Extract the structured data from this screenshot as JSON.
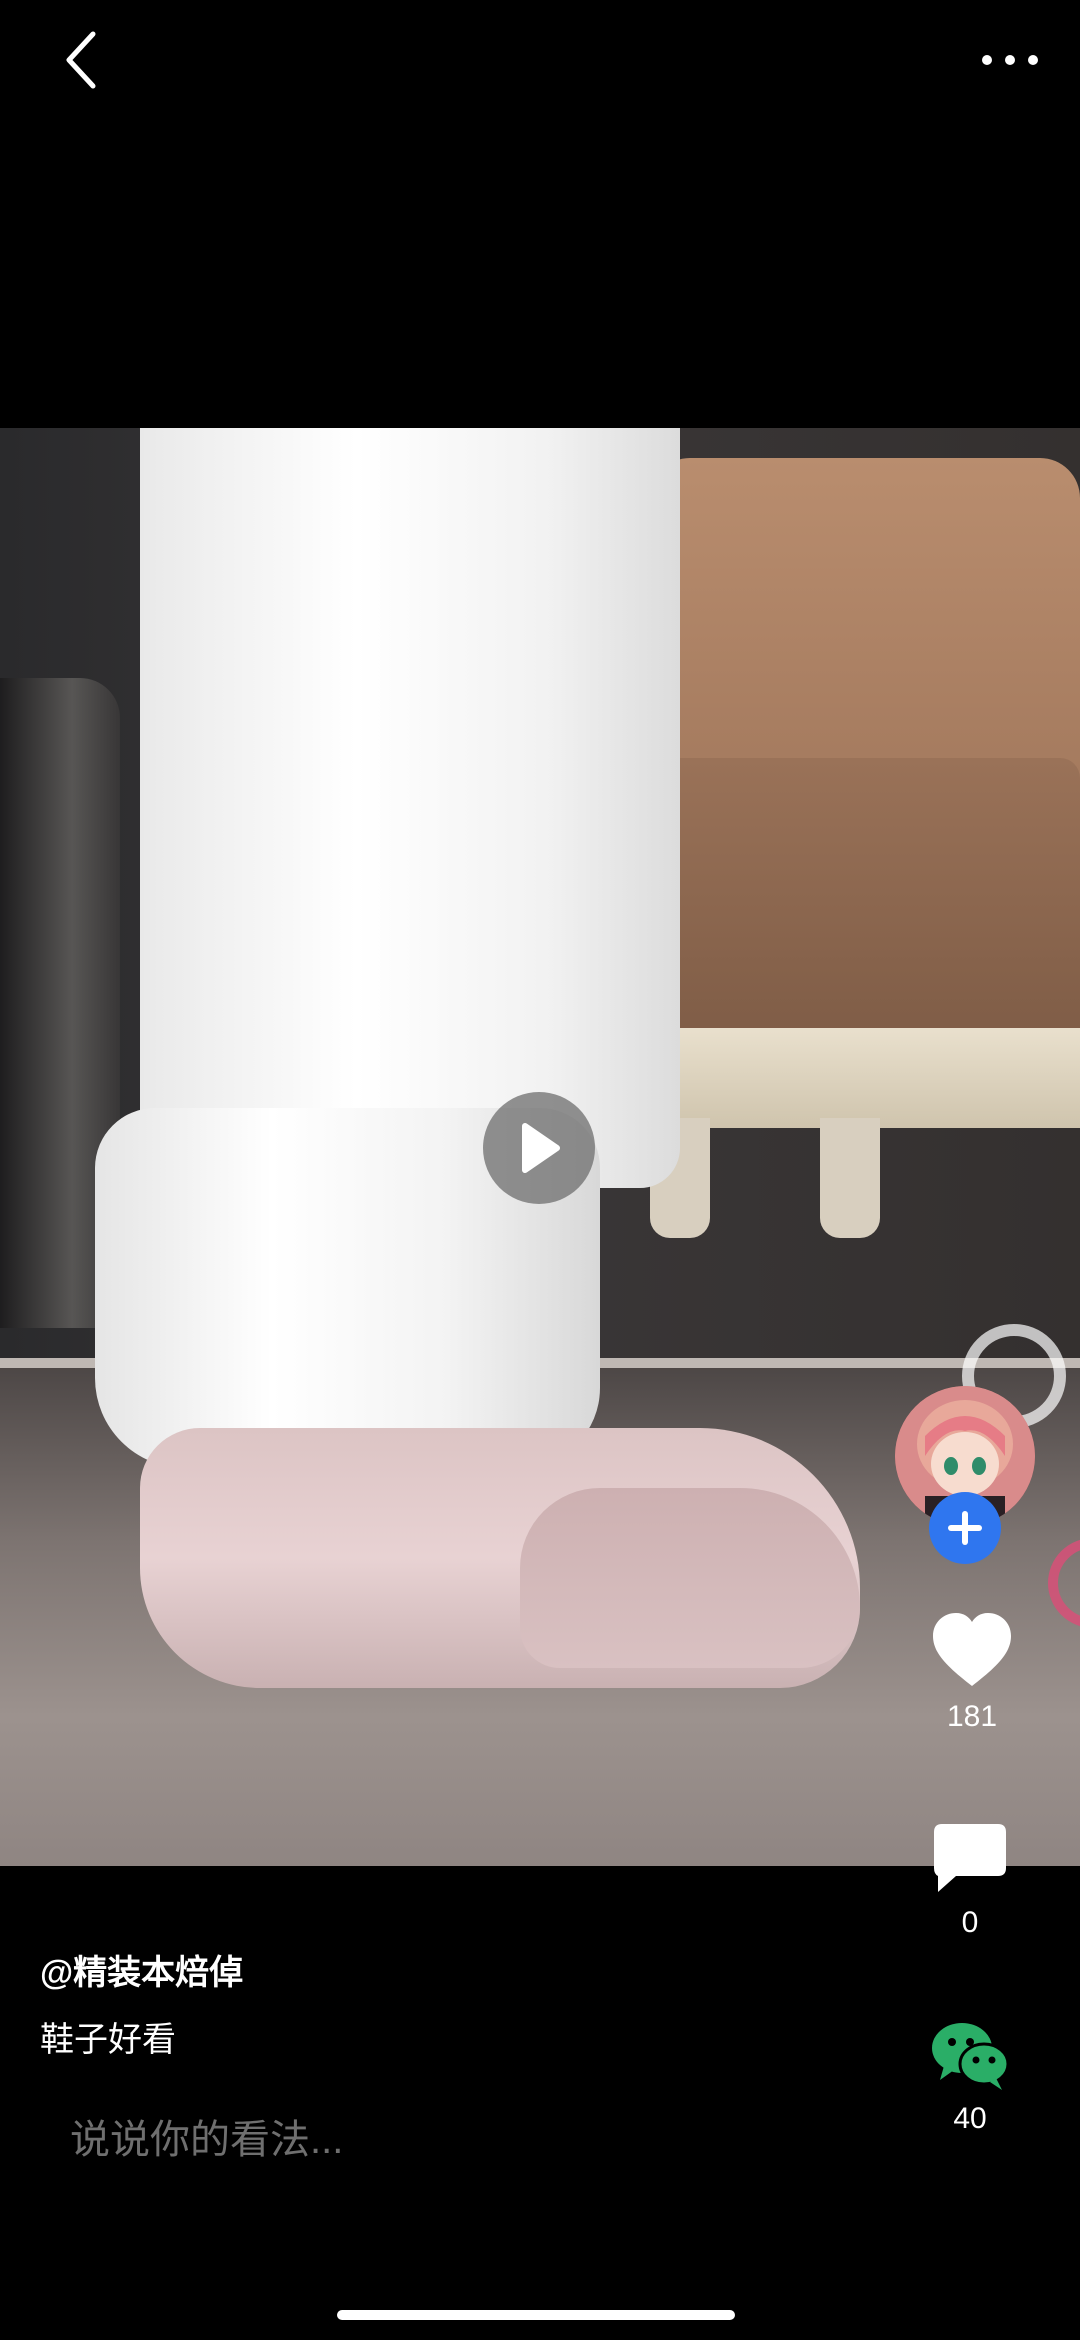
{
  "author": {
    "handle": "@精装本焙倬"
  },
  "caption": "鞋子好看",
  "actions": {
    "likes": "181",
    "comments": "0",
    "shares": "40"
  },
  "comment_input": {
    "placeholder": "说说你的看法..."
  },
  "icons": {
    "back": "chevron-left-icon",
    "more": "more-horizontal-icon",
    "play": "play-icon",
    "like": "heart-icon",
    "comment": "comment-bubble-icon",
    "share": "wechat-icon",
    "follow": "plus-icon"
  },
  "colors": {
    "background": "#000000",
    "follow_button": "#2f76ef",
    "wechat_green": "#2aae67"
  }
}
